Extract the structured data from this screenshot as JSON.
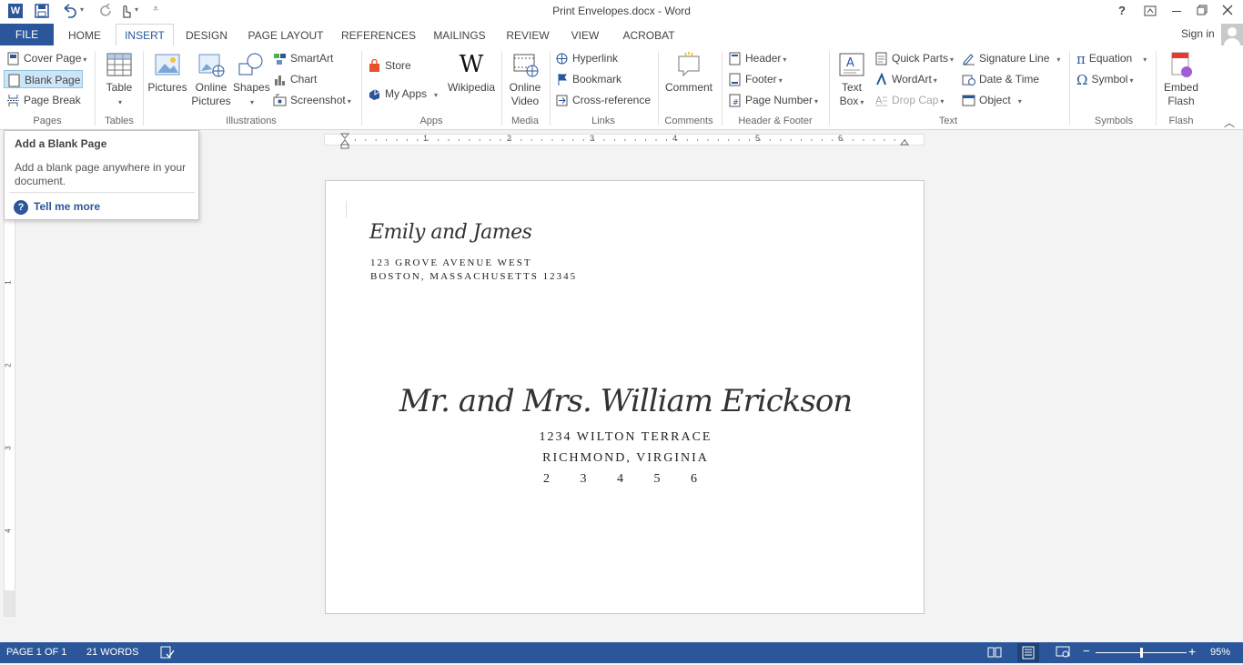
{
  "window": {
    "title": "Print Envelopes.docx - Word",
    "help": "?",
    "sign_in": "Sign in"
  },
  "tabs": [
    "FILE",
    "HOME",
    "INSERT",
    "DESIGN",
    "PAGE LAYOUT",
    "REFERENCES",
    "MAILINGS",
    "REVIEW",
    "VIEW",
    "ACROBAT"
  ],
  "ribbon": {
    "pages": {
      "cover_page": "Cover Page",
      "blank_page": "Blank Page",
      "page_break": "Page Break",
      "group": "Pages"
    },
    "tables": {
      "table": "Table",
      "group": "Tables"
    },
    "illustrations": {
      "pictures": "Pictures",
      "online_pictures_1": "Online",
      "online_pictures_2": "Pictures",
      "shapes": "Shapes",
      "smartart": "SmartArt",
      "chart": "Chart",
      "screenshot": "Screenshot",
      "group": "Illustrations"
    },
    "apps": {
      "store": "Store",
      "my_apps": "My Apps",
      "wikipedia": "Wikipedia",
      "group": "Apps"
    },
    "media": {
      "online_video_1": "Online",
      "online_video_2": "Video",
      "group": "Media"
    },
    "links": {
      "hyperlink": "Hyperlink",
      "bookmark": "Bookmark",
      "cross_reference": "Cross-reference",
      "group": "Links"
    },
    "comments": {
      "comment": "Comment",
      "group": "Comments"
    },
    "header_footer": {
      "header": "Header",
      "footer": "Footer",
      "page_number": "Page Number",
      "group": "Header & Footer"
    },
    "text": {
      "text_box_1": "Text",
      "text_box_2": "Box",
      "quick_parts": "Quick Parts",
      "wordart": "WordArt",
      "drop_cap": "Drop Cap",
      "signature_line": "Signature Line",
      "date_time": "Date & Time",
      "object": "Object",
      "group": "Text"
    },
    "symbols": {
      "equation": "Equation",
      "symbol": "Symbol",
      "group": "Symbols"
    },
    "flash": {
      "embed_1": "Embed",
      "embed_2": "Flash",
      "group": "Flash"
    }
  },
  "tooltip": {
    "title": "Add a Blank Page",
    "body_1": "Add a blank page anywhere in your",
    "body_2": "document.",
    "link": "Tell me more"
  },
  "ruler": {
    "h_numbers": [
      "1",
      "2",
      "3",
      "4",
      "5",
      "6"
    ],
    "v_numbers": [
      "1",
      "2",
      "3",
      "4"
    ]
  },
  "envelope": {
    "return_name": "Emily and James",
    "return_line1": "123 Grove Avenue West",
    "return_line2": "Boston, Massachusetts 12345",
    "recipient_name": "Mr. and Mrs. William Erickson",
    "recipient_line1": "1234 Wilton Terrace",
    "recipient_line2": "Richmond, Virginia",
    "recipient_zip": "2 3 4 5 6"
  },
  "status": {
    "page": "PAGE 1 OF 1",
    "words": "21 WORDS",
    "zoom": "95%",
    "zoom_level": 0.5
  }
}
